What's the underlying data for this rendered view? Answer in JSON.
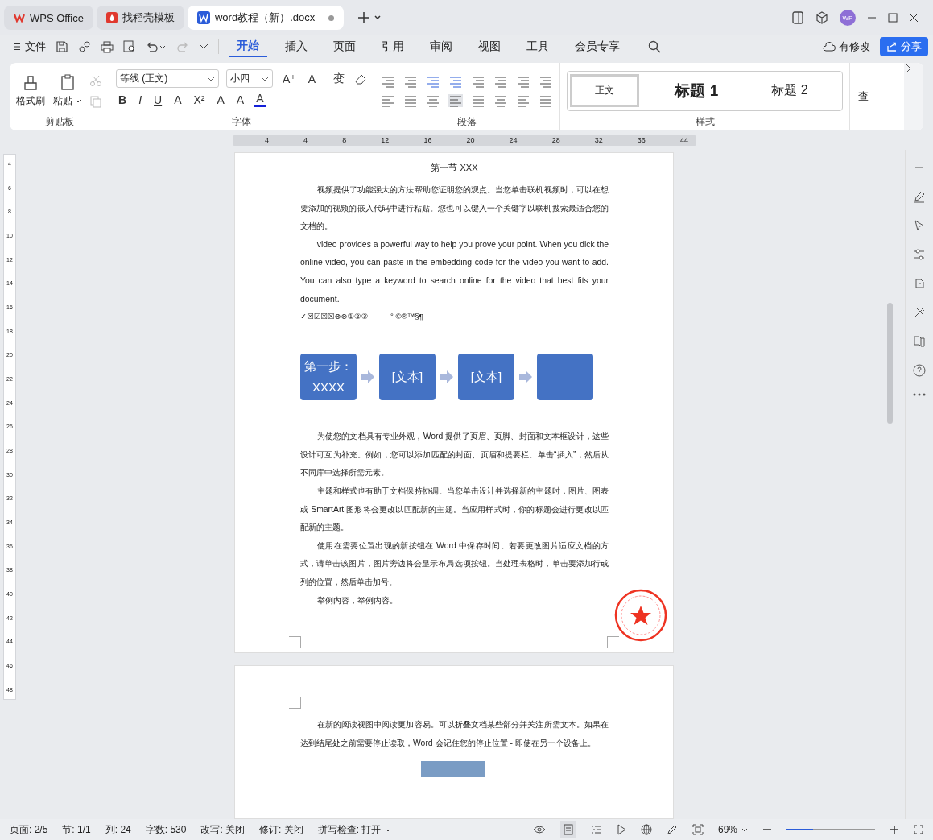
{
  "tabs": [
    {
      "label": "WPS Office",
      "kind": "wps",
      "selected": false
    },
    {
      "label": "找稻壳模板",
      "kind": "docer",
      "selected": false
    },
    {
      "label": "word教程（新）.docx",
      "kind": "doc",
      "selected": true
    }
  ],
  "menu": {
    "file": "文件",
    "tabs": [
      {
        "label": "开始",
        "selected": true
      },
      {
        "label": "插入",
        "selected": false
      },
      {
        "label": "页面",
        "selected": false
      },
      {
        "label": "引用",
        "selected": false
      },
      {
        "label": "审阅",
        "selected": false
      },
      {
        "label": "视图",
        "selected": false
      },
      {
        "label": "工具",
        "selected": false
      },
      {
        "label": "会员专享",
        "selected": false
      }
    ],
    "changes": "有修改",
    "share": "分享",
    "avatar": "WP"
  },
  "ribbon": {
    "clipboard": {
      "title": "剪贴板",
      "format_painter": "格式刷",
      "paste": "粘贴"
    },
    "font": {
      "title": "字体",
      "family": "等线 (正文)",
      "size": "小四",
      "row1": [
        "A⁺",
        "A⁻",
        "变"
      ],
      "row2": [
        "B",
        "I",
        "U",
        "A",
        "X²",
        "A",
        "A",
        "A"
      ]
    },
    "paragraph": {
      "title": "段落"
    },
    "styles": {
      "title": "样式",
      "items": [
        {
          "label": "正文",
          "kind": "normal",
          "selected": true
        },
        {
          "label": "标题 1",
          "kind": "h1",
          "selected": false
        },
        {
          "label": "标题 2",
          "kind": "h2",
          "selected": false
        }
      ]
    },
    "more": "查"
  },
  "ruler": {
    "ticks": [
      "4",
      "4",
      "8",
      "12",
      "16",
      "20",
      "24",
      "28",
      "32",
      "36",
      "44"
    ],
    "vticks": [
      "4",
      "6",
      "8",
      "10",
      "12",
      "14",
      "16",
      "18",
      "20",
      "22",
      "24",
      "26",
      "28",
      "30",
      "32",
      "34",
      "36",
      "38",
      "40",
      "42",
      "44",
      "46",
      "48"
    ]
  },
  "page1": [
    {
      "kind": "heading",
      "text": "第一节 XXX"
    },
    {
      "kind": "para",
      "text": "视频提供了功能强大的方法帮助您证明您的观点。当您单击联机视频时，可以在想要添加的视频的嵌入代码中进行粘贴。您也可以键入一个关键字以联机搜索最适合您的文档的。"
    },
    {
      "kind": "para",
      "text": "video provides a powerful way to help you prove your point. When you dick the online video, you can paste in the embedding code for the video you want to add. You can also type a keyword to search online for the video that best fits your document."
    },
    {
      "kind": "symbols",
      "text": "✓☒☑☒☒⊗⊗①②③——  -     °   ©®™§¶···"
    },
    {
      "kind": "diagram",
      "steps": [
        {
          "kind": "text",
          "text": "第一步：XXXX"
        },
        {
          "kind": "text",
          "text": "[文本]"
        },
        {
          "kind": "text",
          "text": "[文本]"
        },
        {
          "kind": "blank"
        }
      ]
    },
    {
      "kind": "para",
      "text": "为使您的文档具有专业外观，Word 提供了页眉、页脚、封面和文本框设计，这些设计可互为补充。例如，您可以添加匹配的封面、页眉和提要栏。单击“插入”，然后从不同库中选择所需元素。"
    },
    {
      "kind": "para",
      "text": "主题和样式也有助于文档保持协调。当您单击设计并选择新的主题时，图片、图表或 SmartArt 图形将会更改以匹配新的主题。当应用样式时，你的标题会进行更改以匹配新的主题。"
    },
    {
      "kind": "para",
      "text": "使用在需要位置出现的新按钮在 Word 中保存时间。若要更改图片适应文档的方式，请单击该图片，图片旁边将会显示布局选项按钮。当处理表格时，单击要添加行或列的位置，然后单击加号。"
    },
    {
      "kind": "para",
      "text": "举例内容，举例内容。"
    }
  ],
  "page2": [
    {
      "kind": "para",
      "text": "在新的阅读视图中阅读更加容易。可以折叠文档某些部分并关注所需文本。如果在达到结尾处之前需要停止读取，Word 会记住您的停止位置 - 即使在另一个设备上。"
    }
  ],
  "status": {
    "items": [
      "页面: 2/5",
      "节: 1/1",
      "列: 24",
      "字数: 530",
      "改写: 关闭",
      "修订: 关闭"
    ],
    "spell": "拼写检查: 打开",
    "zoom": "69%",
    "zoom_slider": {
      "level": 0.3
    }
  }
}
